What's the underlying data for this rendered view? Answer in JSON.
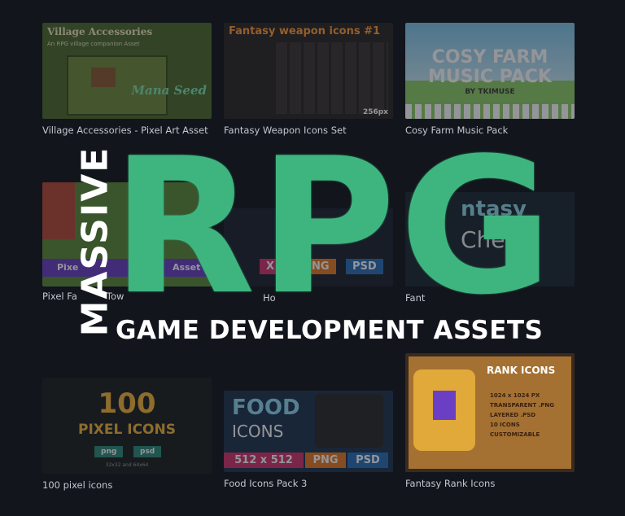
{
  "colors": {
    "background": "#12151c",
    "card_title": "#c3c7cf",
    "rpg_green": "#3eb57f",
    "overlay_white": "#ffffff"
  },
  "overlay": {
    "vertical_word": "MASSIVE",
    "big_word": "RPG",
    "subtitle": "GAME DEVELOPMENT ASSETS"
  },
  "cards": {
    "village": {
      "title": "Village Accessories - Pixel Art Asset",
      "thumb_heading": "Village Accessories",
      "thumb_blurb": "An RPG village companion Asset",
      "thumb_logo": "Mana Seed"
    },
    "weapons": {
      "title": "Fantasy Weapon Icons Set",
      "thumb_heading": "Fantasy weapon icons #1",
      "thumb_list": [
        "- 180 unique weapon images",
        "- 2 types of background",
        "- Crop & Spritesheets",
        "- Total 360 files:",
        "Daggers",
        "Bows",
        "Axes",
        "Swords",
        "Shields",
        "Hammers",
        "Spears",
        "Throws",
        "Staffs",
        "Magic Artifacts"
      ],
      "thumb_size": "256px"
    },
    "cosy": {
      "title": "Cosy Farm Music Pack",
      "thumb_line1": "COSY FARM",
      "thumb_line2": "MUSIC PACK",
      "thumb_by": "BY TKIMUSE"
    },
    "pixel_fantasy": {
      "title_part1": "Pixel Fa",
      "title_part2": "Tow",
      "banner_part1": "Pixe",
      "banner_part2": "ca",
      "banner_part3": "Asset"
    },
    "middle": {
      "title_part": "Ho",
      "pill_x": "X",
      "pill_png": "NG",
      "pill_psd": "PSD"
    },
    "fantasy_right": {
      "title_part": "Fant",
      "thumb_text1": "ntasy",
      "thumb_text2": "Che"
    },
    "pixel_icons": {
      "title": "100 pixel icons",
      "thumb_big": "100",
      "thumb_sub": "PIXEL ICONS",
      "pill_png": "png",
      "pill_psd": "psd",
      "thumb_sizes": "32x32 and 64x64"
    },
    "food": {
      "title": "Food Icons Pack 3",
      "thumb_food": "FOOD",
      "thumb_icons": "ICONS",
      "pill_size": "512 x 512",
      "pill_png": "PNG",
      "pill_psd": "PSD"
    },
    "rank": {
      "title": "Fantasy Rank Icons",
      "thumb_heading": "RANK ICONS",
      "thumb_list": [
        "1024 x 1024 PX",
        "TRANSPARENT .PNG",
        "LAYERED .PSD",
        "10 ICONS",
        "CUSTOMIZABLE"
      ]
    }
  }
}
